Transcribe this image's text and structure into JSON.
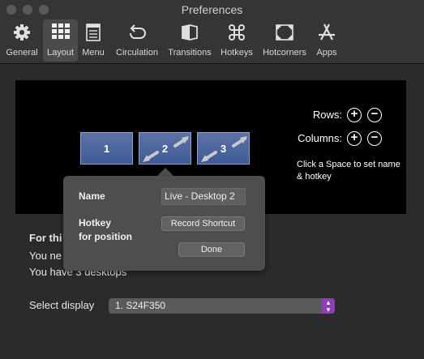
{
  "window": {
    "title": "Preferences"
  },
  "toolbar": {
    "items": [
      {
        "label": "General",
        "icon": "gear-icon"
      },
      {
        "label": "Layout",
        "icon": "grid-icon",
        "active": true
      },
      {
        "label": "Menu",
        "icon": "menu-list-icon"
      },
      {
        "label": "Circulation",
        "icon": "circular-arrow-icon"
      },
      {
        "label": "Transitions",
        "icon": "cube-icon"
      },
      {
        "label": "Hotkeys",
        "icon": "command-key-icon"
      },
      {
        "label": "Hotcorners",
        "icon": "corners-icon"
      },
      {
        "label": "Apps",
        "icon": "app-store-icon"
      }
    ]
  },
  "layout": {
    "rows_label": "Rows:",
    "columns_label": "Columns:",
    "hint": "Click a Space to set name & hotkey",
    "spaces": [
      {
        "number": "1"
      },
      {
        "number": "2"
      },
      {
        "number": "3"
      }
    ]
  },
  "popover": {
    "name_label": "Name",
    "name_value": "Live - Desktop 2",
    "hotkey_label_line1": "Hotkey",
    "hotkey_label_line2": "for position",
    "record_shortcut_label": "Record Shortcut",
    "done_label": "Done"
  },
  "info": {
    "heading": "For thi",
    "line1": "You ne",
    "line2": "You have 3 desktops"
  },
  "display": {
    "label": "Select display",
    "selected": "1. S24F350"
  },
  "colors": {
    "accent": "#8e3fb3",
    "space_fill": "#4f67a0"
  }
}
